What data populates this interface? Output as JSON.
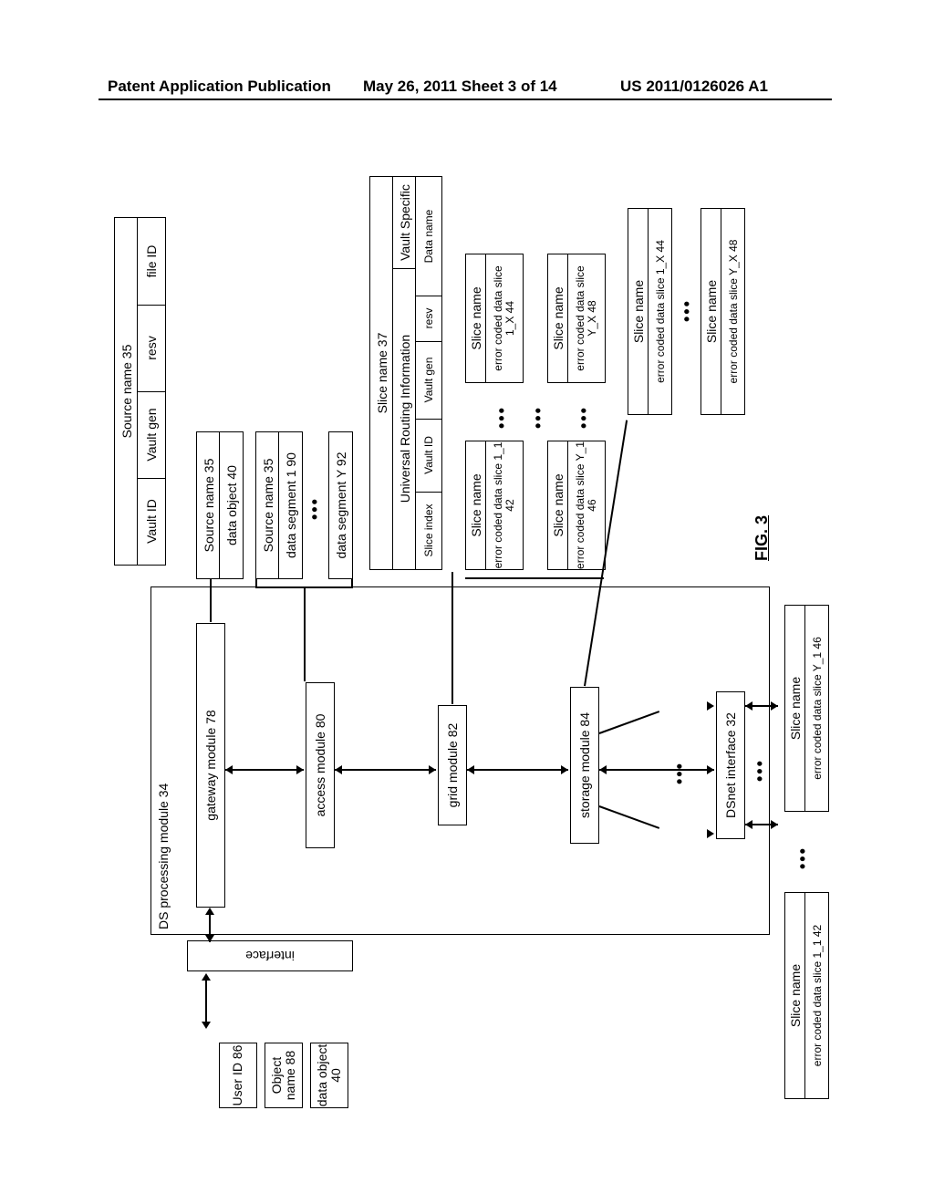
{
  "header": {
    "left": "Patent Application Publication",
    "mid": "May 26, 2011  Sheet 3 of 14",
    "right": "US 2011/0126026 A1"
  },
  "fig_label": "FIG. 3",
  "user_id": "User ID 86",
  "object_name": "Object name 88",
  "data_object_40": "data object 40",
  "interface_label": "interface",
  "ds_proc_module": "DS processing module 34",
  "gateway": "gateway module 78",
  "access": "access module 80",
  "grid": "grid module 82",
  "storage": "storage module 84",
  "dsnet": "DSnet interface 32",
  "source_name_35": "Source name 35",
  "vault_id": "Vault ID",
  "vault_gen": "Vault gen",
  "resv": "resv",
  "file_id": "file ID",
  "data_object_40b": "data object 40",
  "data_segment_1": "data segment 1 90",
  "data_segment_y": "data segment Y 92",
  "slice_name_37": "Slice name 37",
  "universal_routing": "Universal Routing Information",
  "vault_specific": "Vault Specific",
  "data_name": "Data name",
  "slice_index": "Slice index",
  "slice_name": "Slice name",
  "ec_slice_11_42": "error coded data slice 1_1 42",
  "ec_slice_1x_44": "error coded data slice 1_X 44",
  "ec_slice_y1_46": "error coded data slice Y_1 46",
  "ec_slice_yx_48": "error coded data slice Y_X 48",
  "ec_slice_11_42_short": "error coded data slice 1_1 42",
  "ec_slice_1x_44_short": "error coded data slice 1_X 44",
  "ec_slice_y1_46_short": "error coded data slice Y_1 46",
  "ec_slice_yx_48_short": "error coded data slice Y_X 48"
}
